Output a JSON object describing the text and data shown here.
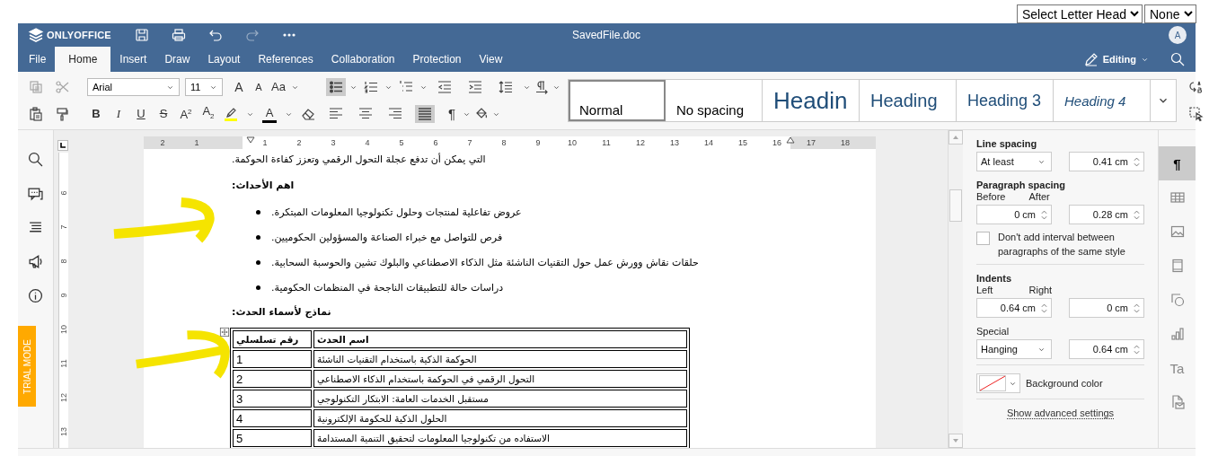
{
  "letter_head": [
    {
      "value": "Select Letter Head"
    },
    {
      "value": "None"
    }
  ],
  "header": {
    "logo": "ONLYOFFICE",
    "title": "SavedFile.doc",
    "avatar": "A",
    "mode": "Editing"
  },
  "tabs": [
    {
      "label": "File",
      "selected": false
    },
    {
      "label": "Home",
      "selected": true
    },
    {
      "label": "Insert",
      "selected": false
    },
    {
      "label": "Draw",
      "selected": false
    },
    {
      "label": "Layout",
      "selected": false
    },
    {
      "label": "References",
      "selected": false
    },
    {
      "label": "Collaboration",
      "selected": false
    },
    {
      "label": "Protection",
      "selected": false
    },
    {
      "label": "View",
      "selected": false
    }
  ],
  "toolbar": {
    "font": "Arial",
    "size": "11",
    "size_buttons": [
      {
        "kind": "grow",
        "glyph": "A"
      },
      {
        "kind": "shrink",
        "glyph": "A"
      },
      {
        "kind": "case",
        "glyph": "Aa"
      }
    ],
    "list_buttons": [
      {
        "kind": "bullets",
        "selected": true
      },
      {
        "kind": "numbering",
        "selected": false
      },
      {
        "kind": "multilevel",
        "selected": false
      }
    ],
    "format_buttons": [
      {
        "kind": "bold",
        "glyph": "B"
      },
      {
        "kind": "italic",
        "glyph": "I"
      },
      {
        "kind": "underline",
        "glyph": "U"
      },
      {
        "kind": "strikeout",
        "glyph": "S"
      },
      {
        "kind": "superscript",
        "glyph": "A$^{2}$"
      },
      {
        "kind": "subscript",
        "glyph": "A$_{2}$"
      }
    ],
    "font_color_glyph": "A",
    "align_buttons": [
      {
        "kind": "left",
        "selected": false
      },
      {
        "kind": "center",
        "selected": false
      },
      {
        "kind": "right",
        "selected": false
      },
      {
        "kind": "justify",
        "selected": true
      }
    ],
    "pilcrow": "¶",
    "styles": [
      {
        "kind": "normal",
        "label": "Normal",
        "selected": true
      },
      {
        "kind": "no_spacing",
        "label": "No spacing",
        "selected": false
      },
      {
        "kind": "heading1",
        "label": "Headin",
        "selected": false
      },
      {
        "kind": "heading2",
        "label": "Heading",
        "selected": false
      },
      {
        "kind": "heading3",
        "label": "Heading 3",
        "selected": false
      },
      {
        "kind": "heading4",
        "label": "Heading 4",
        "selected": false
      }
    ]
  },
  "left_sidebar": {
    "items": [
      {
        "kind": "search"
      },
      {
        "kind": "comments"
      },
      {
        "kind": "navigation"
      },
      {
        "kind": "feedback"
      },
      {
        "kind": "about"
      }
    ],
    "trial_badge": "TRIAL MODE"
  },
  "rulers": {
    "horizontal": [
      "2",
      "1",
      "1",
      "2",
      "3",
      "4",
      "5",
      "6",
      "7",
      "8",
      "9",
      "10",
      "11",
      "12",
      "13",
      "14",
      "15",
      "16",
      "17",
      "18"
    ],
    "vertical": [
      "6",
      "7",
      "8",
      "9",
      "10",
      "11",
      "12",
      "13"
    ]
  },
  "document": {
    "blocks": [
      {
        "kind": "paragraph",
        "text": "التي يمكن أن تدفع عجلة التحول الرقمي وتعزز كفاءة الحوكمة."
      },
      {
        "kind": "heading",
        "text": "اهم الأحداث:"
      },
      {
        "kind": "bullet",
        "text": "عروض تفاعلية لمنتجات وحلول تكنولوجيا المعلومات المبتكرة."
      },
      {
        "kind": "bullet",
        "text": "فرص للتواصل مع خبراء الصناعة والمسؤولين الحكوميين."
      },
      {
        "kind": "bullet",
        "text": "حلقات نقاش وورش عمل حول التقنيات الناشئة مثل الذكاء الاصطناعي والبلوك تشين والحوسبة السحابية."
      },
      {
        "kind": "bullet",
        "text": "دراسات حالة للتطبيقات الناجحة في المنظمات الحكومية."
      },
      {
        "kind": "heading",
        "text": "نماذج لأسماء الحدث:"
      },
      {
        "kind": "table",
        "columns": [
          "رقم تسلسلي",
          "اسم الحدث"
        ],
        "rows": [
          [
            "1",
            "الحوكمة الذكية باستخدام التقنيات الناشئة"
          ],
          [
            "2",
            "التحول الرقمي في الحوكمة باستخدام الذكاء الاصطناعي"
          ],
          [
            "3",
            "مستقبل الخدمات العامة: الابتكار التكنولوجي"
          ],
          [
            "4",
            "الحلول الذكية للحكومة الإلكترونية"
          ],
          [
            "5",
            "الاستفاده من تكنولوجيا المعلومات لتحقيق التنمية المستدامة"
          ]
        ]
      }
    ]
  },
  "paragraph_settings": {
    "line_spacing": {
      "label": "Line spacing",
      "rule": "At least",
      "value": "0.41 cm"
    },
    "paragraph_spacing": {
      "label": "Paragraph spacing",
      "before_label": "Before",
      "before": "0 cm",
      "after_label": "After",
      "after": "0.28 cm"
    },
    "no_interval": {
      "label": "Don't add interval between paragraphs of the same style",
      "checked": false
    },
    "indents": {
      "label": "Indents",
      "left_label": "Left",
      "left": "0.64 cm",
      "right_label": "Right",
      "right": "0 cm",
      "special_label": "Special",
      "special": "Hanging",
      "special_value": "0.64 cm"
    },
    "background_color": {
      "label": "Background color"
    },
    "advanced_link": "Show advanced settings"
  },
  "right_bar": [
    {
      "kind": "paragraph",
      "glyph": "¶",
      "selected": true
    },
    {
      "kind": "table",
      "selected": false
    },
    {
      "kind": "image",
      "selected": false
    },
    {
      "kind": "header_footer",
      "selected": false
    },
    {
      "kind": "shape",
      "selected": false
    },
    {
      "kind": "chart",
      "selected": false
    },
    {
      "kind": "text_art",
      "glyph": "Ta",
      "selected": false
    },
    {
      "kind": "mail_merge",
      "selected": false
    }
  ]
}
